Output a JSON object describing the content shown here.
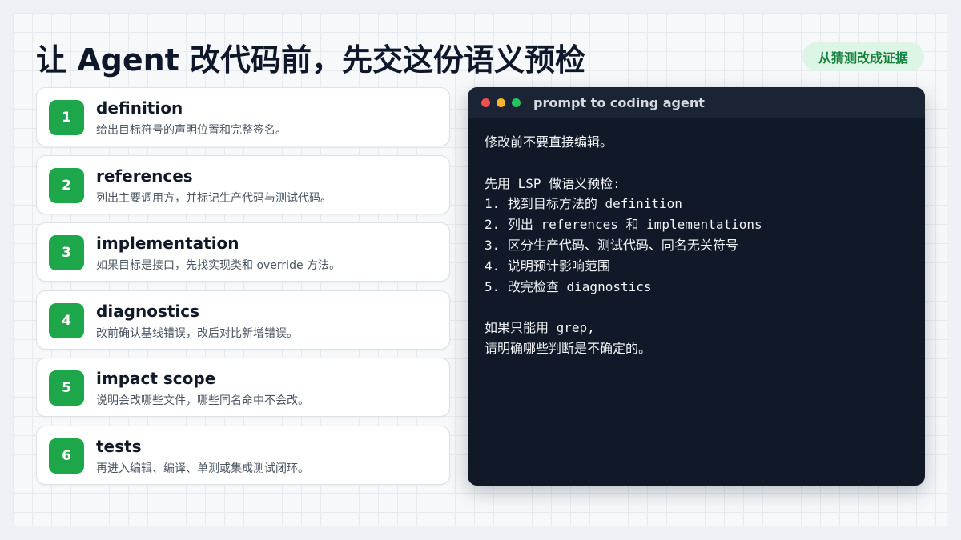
{
  "title": "让 Agent 改代码前，先交这份语义预检",
  "badge": "从猜测改成证据",
  "steps": [
    {
      "num": "1",
      "name": "definition",
      "desc": "给出目标符号的声明位置和完整签名。"
    },
    {
      "num": "2",
      "name": "references",
      "desc": "列出主要调用方，并标记生产代码与测试代码。"
    },
    {
      "num": "3",
      "name": "implementation",
      "desc": "如果目标是接口，先找实现类和 override 方法。"
    },
    {
      "num": "4",
      "name": "diagnostics",
      "desc": "改前确认基线错误，改后对比新增错误。"
    },
    {
      "num": "5",
      "name": "impact scope",
      "desc": "说明会改哪些文件，哪些同名命中不会改。"
    },
    {
      "num": "6",
      "name": "tests",
      "desc": "再进入编辑、编译、单测或集成测试闭环。"
    }
  ],
  "terminal": {
    "title": "prompt to coding agent",
    "lines": [
      "修改前不要直接编辑。",
      "",
      "先用 LSP 做语义预检:",
      "1. 找到目标方法的 definition",
      "2. 列出 references 和 implementations",
      "3. 区分生产代码、测试代码、同名无关符号",
      "4. 说明预计影响范围",
      "5. 改完检查 diagnostics",
      "",
      "如果只能用 grep,",
      "请明确哪些判断是不确定的。"
    ]
  },
  "colors": {
    "accent": "#1ea64a",
    "badge_bg": "#dcf5e4",
    "badge_text": "#15803d",
    "terminal_bg": "#111827"
  }
}
